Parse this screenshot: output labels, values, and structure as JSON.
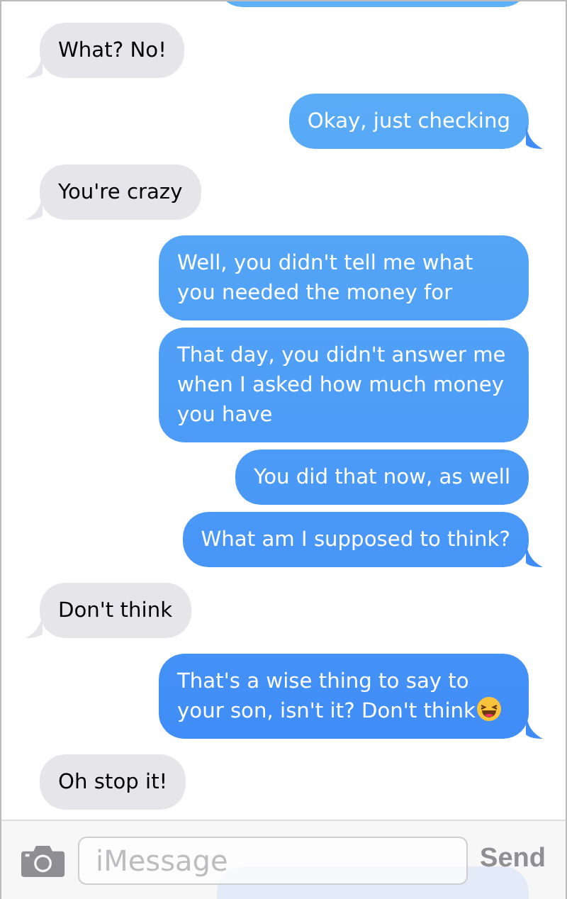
{
  "messages": [
    {
      "outgoing": true,
      "kind": "clipped"
    },
    {
      "outgoing": false,
      "kind": "text",
      "text": "What? No!",
      "tail": true
    },
    {
      "outgoing": true,
      "kind": "text",
      "text": "Okay, just checking",
      "tail": true
    },
    {
      "outgoing": false,
      "kind": "text",
      "text": "You're crazy",
      "tail": true
    },
    {
      "outgoing": true,
      "kind": "text",
      "text": "Well, you didn't tell me what you needed the money for",
      "tail": false
    },
    {
      "outgoing": true,
      "kind": "text",
      "text": "That day, you didn't answer me when I asked how much money you have",
      "tail": false
    },
    {
      "outgoing": true,
      "kind": "text",
      "text": "You did that now, as well",
      "tail": false
    },
    {
      "outgoing": true,
      "kind": "text",
      "text": "What am I supposed to think?",
      "tail": true
    },
    {
      "outgoing": false,
      "kind": "text",
      "text": "Don't think",
      "tail": true
    },
    {
      "outgoing": true,
      "kind": "text",
      "text": "That's a wise thing to say to your son, isn't it? Don't think",
      "trailing_emoji": true,
      "tail": true
    },
    {
      "outgoing": false,
      "kind": "text",
      "text": "Oh stop it!",
      "tail": false
    },
    {
      "outgoing": true,
      "kind": "clipped"
    }
  ],
  "composer": {
    "placeholder": "iMessage",
    "send": "Send"
  }
}
